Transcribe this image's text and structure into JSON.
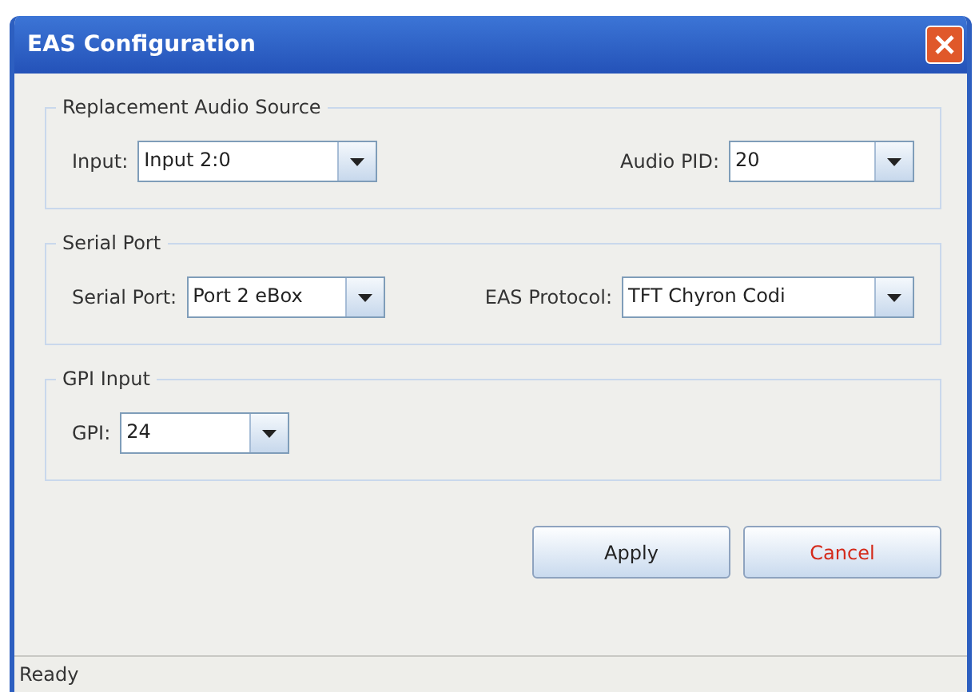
{
  "window": {
    "title": "EAS Configuration"
  },
  "groups": [
    {
      "title": "Replacement Audio Source",
      "fields": [
        {
          "label": "Input:",
          "value": "Input 2:0"
        },
        {
          "label": "Audio PID:",
          "value": "20"
        }
      ]
    },
    {
      "title": "Serial Port",
      "fields": [
        {
          "label": "Serial Port:",
          "value": "Port 2 eBox"
        },
        {
          "label": "EAS Protocol:",
          "value": "TFT Chyron Codi"
        }
      ]
    },
    {
      "title": "GPI Input",
      "fields": [
        {
          "label": "GPI:",
          "value": "24"
        }
      ]
    }
  ],
  "buttons": [
    {
      "label": "Apply",
      "kind": "normal"
    },
    {
      "label": "Cancel",
      "kind": "cancel"
    }
  ],
  "status_bar": "Ready"
}
